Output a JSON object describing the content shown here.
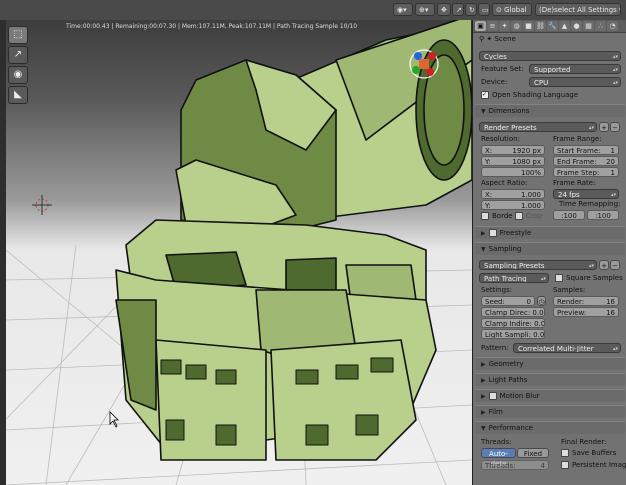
{
  "topbar": {
    "global_label": "Global",
    "deselect_label": "(De)select All Settings"
  },
  "viewport": {
    "info": "Time:00:00.43 | Remaining:00:07.30 | Mem:107.11M, Peak:107.11M | Path Tracing Sample 10/10"
  },
  "props": {
    "context_label": "Scene",
    "engine": "Cycles",
    "feature_set_label": "Feature Set:",
    "feature_set_value": "Supported",
    "device_label": "Device:",
    "device_value": "CPU",
    "osl_label": "Open Shading Language",
    "dimensions": {
      "header": "Dimensions",
      "render_presets": "Render Presets",
      "resolution_label": "Resolution:",
      "res_x_key": "X:",
      "res_x": "1920 px",
      "res_y_key": "Y:",
      "res_y": "1080 px",
      "res_pct": "100%",
      "frame_range_label": "Frame Range:",
      "start_key": "Start Frame:",
      "start": "1",
      "end_key": "End Frame:",
      "end": "20",
      "step_key": "Frame Step:",
      "step": "1",
      "aspect_label": "Aspect Ratio:",
      "asp_x_key": "X:",
      "asp_x": "1.000",
      "asp_y_key": "Y:",
      "asp_y": "1.000",
      "frame_rate_label": "Frame Rate:",
      "frame_rate": "24 fps",
      "time_remap_label": "Time Remapping:",
      "remap_old": ":100",
      "remap_new": ":100",
      "border_label": "Borde",
      "crop_label": "Crop"
    },
    "freestyle_header": "Freestyle",
    "sampling": {
      "header": "Sampling",
      "presets": "Sampling Presets",
      "integrator": "Path Tracing",
      "square_samples": "Square Samples",
      "settings_label": "Settings:",
      "seed_key": "Seed:",
      "seed": "0",
      "clamp_direct": "Clamp Direc: 0.00",
      "clamp_indirect": "Clamp Indire: 0.00",
      "light_sampling": "Light Sampli: 0.00",
      "samples_label": "Samples:",
      "render_key": "Render:",
      "render": "16",
      "preview_key": "Preview:",
      "preview": "16",
      "pattern_label": "Pattern:",
      "pattern_value": "Correlated Multi-Jitter"
    },
    "collapsed_panels": [
      "Geometry",
      "Light Paths",
      "Motion Blur",
      "Film"
    ],
    "performance": {
      "header": "Performance",
      "threads_label": "Threads:",
      "auto_detect": "Auto-dete",
      "fixed": "Fixed",
      "threads_key": "Threads:",
      "threads_val": "4",
      "final_render_label": "Final Render:",
      "save_buffers": "Save Buffers",
      "persistent_images": "Persistent Images"
    }
  },
  "colors": {
    "tank_fill": "#b8d08c",
    "tank_shadow": "#4f6a2e",
    "header_bg": "#4a4a4a",
    "panel_bg": "#727272",
    "active_button": "#5a7fb8"
  }
}
